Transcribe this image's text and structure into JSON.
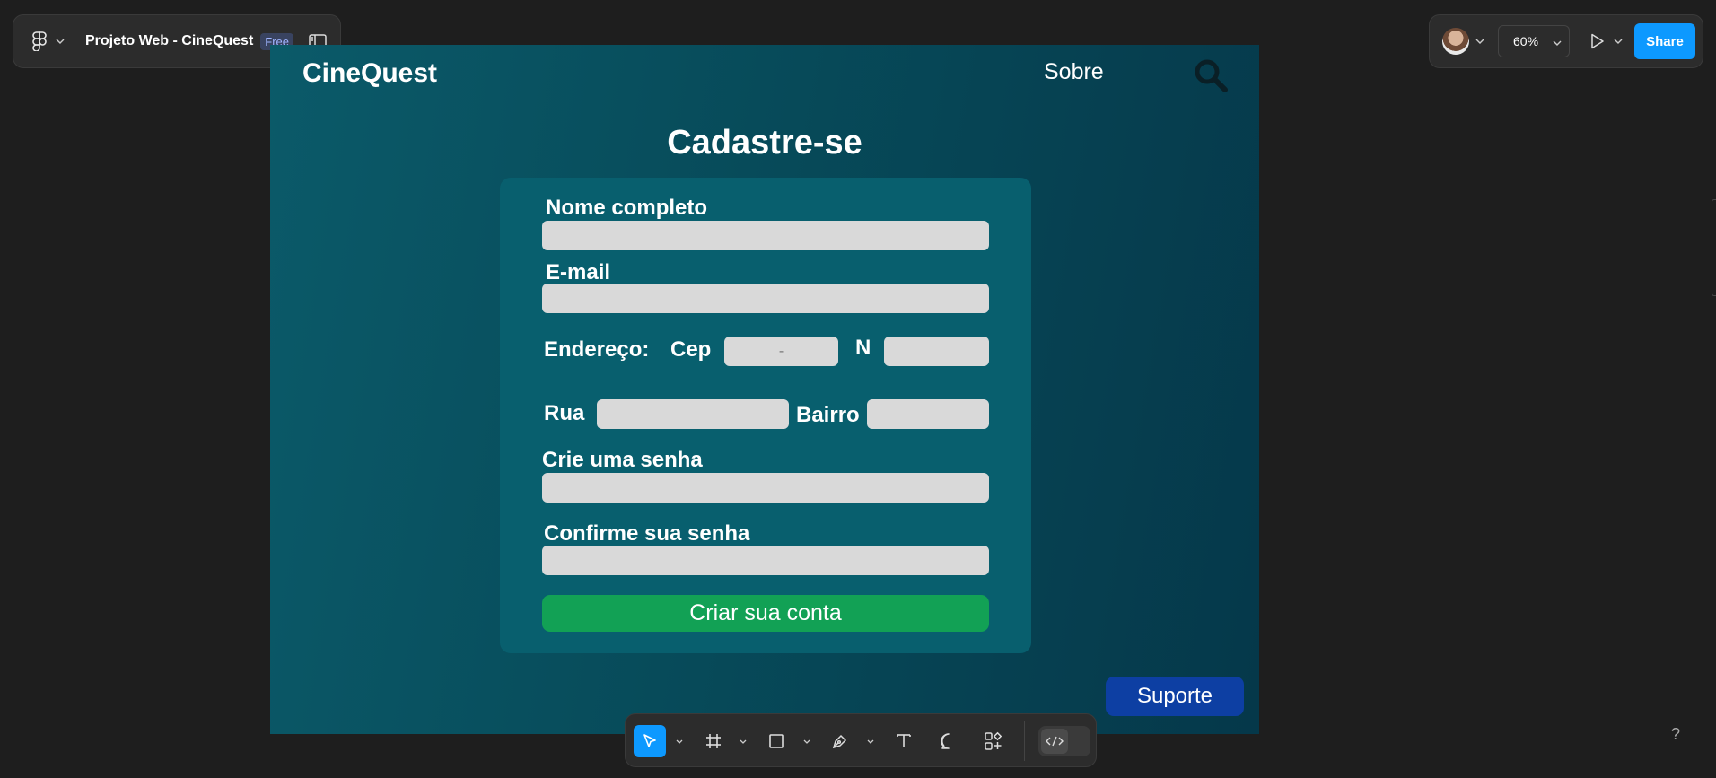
{
  "file": {
    "name": "Projeto Web - CineQuest",
    "plan_badge": "Free"
  },
  "view": {
    "zoom": "60%",
    "share_label": "Share"
  },
  "site": {
    "brand": "CineQuest",
    "nav_sobre": "Sobre",
    "title": "Cadastre-se",
    "form": {
      "name_label": "Nome completo",
      "email_label": "E-mail",
      "address_label": "Endereço:",
      "cep_label": "Cep",
      "cep_value": "-",
      "number_label": "N",
      "street_label": "Rua",
      "district_label": "Bairro",
      "password_label": "Crie uma senha",
      "confirm_label": "Confirme sua senha",
      "submit_label": "Criar sua conta"
    },
    "support_label": "Suporte"
  },
  "help_label": "?",
  "colors": {
    "editor_bg": "#1e1e1e",
    "panel_bg": "#2c2c2c",
    "accent": "#0d99ff",
    "frame_bg": "#074b5a",
    "card_bg": "#085f6e",
    "field_bg": "#d9d9d9",
    "cta_bg": "#12a155",
    "support_bg": "#0d3fa3"
  },
  "icons": {
    "main_menu": "figma-logo-icon",
    "sidebar": "sidebar-toggle-icon",
    "play": "play-icon",
    "search": "search-icon",
    "tools": [
      "move-tool-icon",
      "frame-tool-icon",
      "rectangle-tool-icon",
      "pen-tool-icon",
      "text-tool-icon",
      "comment-tool-icon",
      "actions-icon",
      "dev-mode-icon"
    ]
  }
}
